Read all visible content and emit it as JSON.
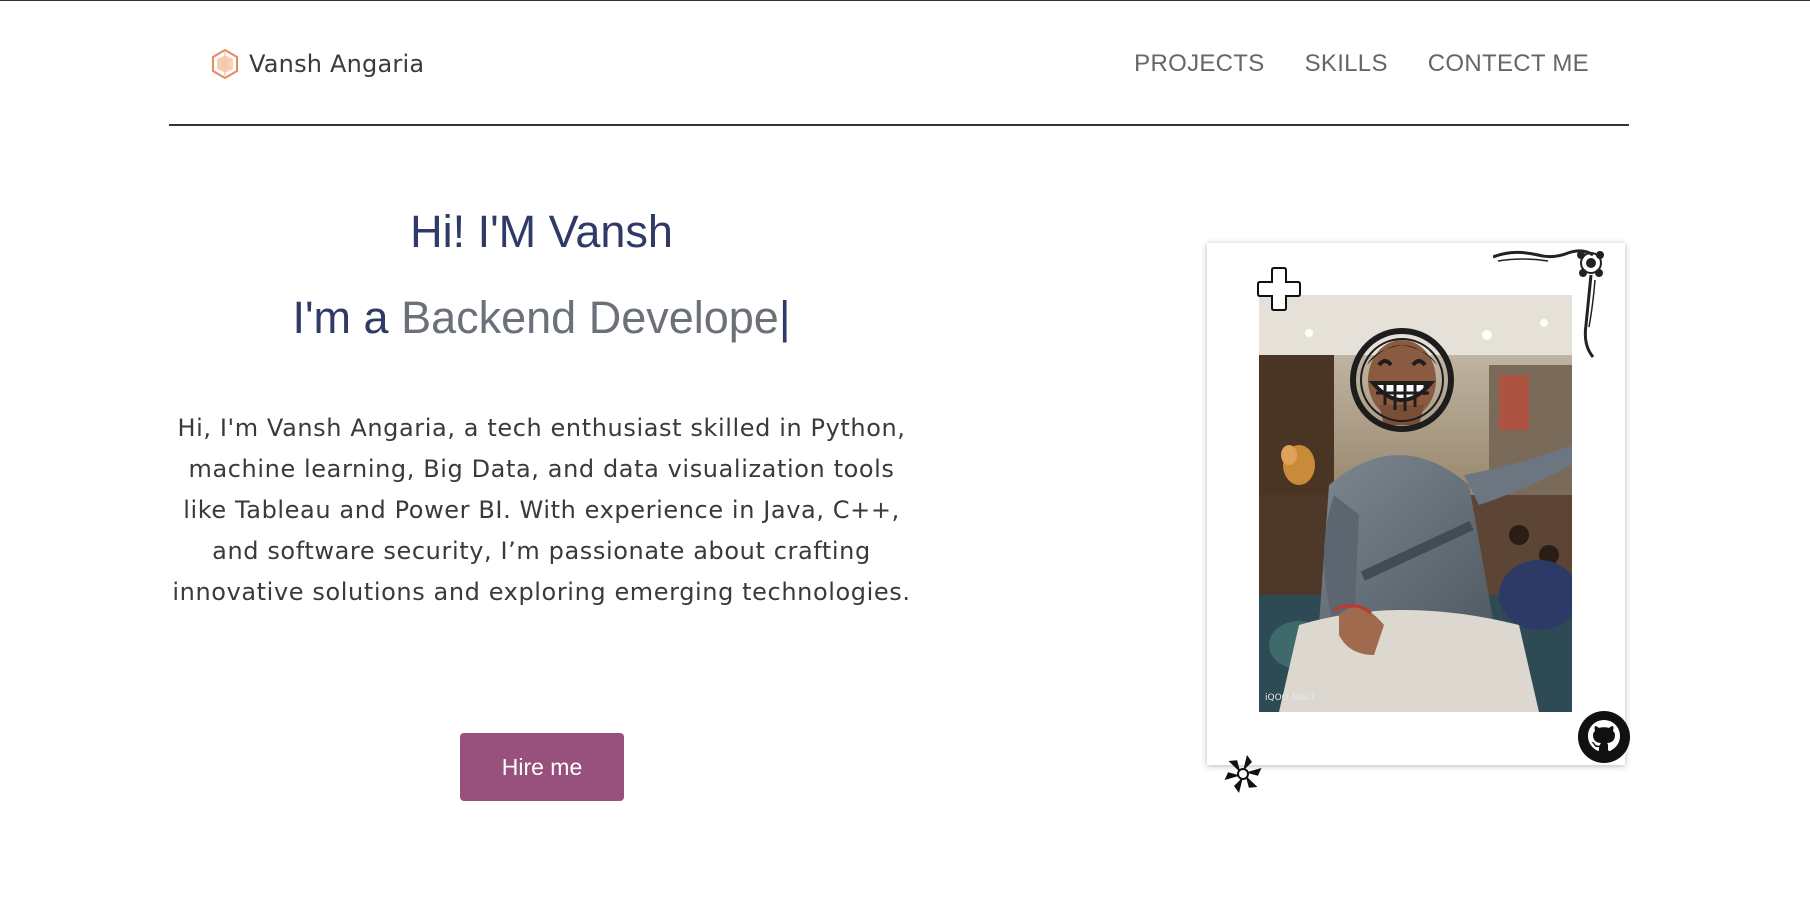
{
  "brand": {
    "name": "Vansh Angaria",
    "logo_icon": "hexagon-logo-icon",
    "logo_color": "#e8895a"
  },
  "nav": {
    "items": [
      {
        "label": "PROJECTS"
      },
      {
        "label": "SKILLS"
      },
      {
        "label": "CONTECT ME"
      }
    ]
  },
  "hero": {
    "title": "Hi! I'M Vansh",
    "role_prefix": "I'm a ",
    "role_typed": "Backend Develope",
    "cursor": "|",
    "bio": "Hi, I'm Vansh Angaria, a tech enthusiast skilled in Python, machine learning, Big Data, and data visualization tools like Tableau and Power BI. With experience in Java, C++, and software security, I’m passionate about crafting innovative solutions and exploring emerging technologies.",
    "cta_label": "Hire me",
    "cta_color": "#98507c",
    "title_color": "#303a66"
  },
  "photo": {
    "watermark": "iQOO Neo7",
    "icons": [
      "plus-icon",
      "grinning-face-icon",
      "github-icon",
      "spiral-star-icon",
      "floral-corner-ornament"
    ]
  }
}
